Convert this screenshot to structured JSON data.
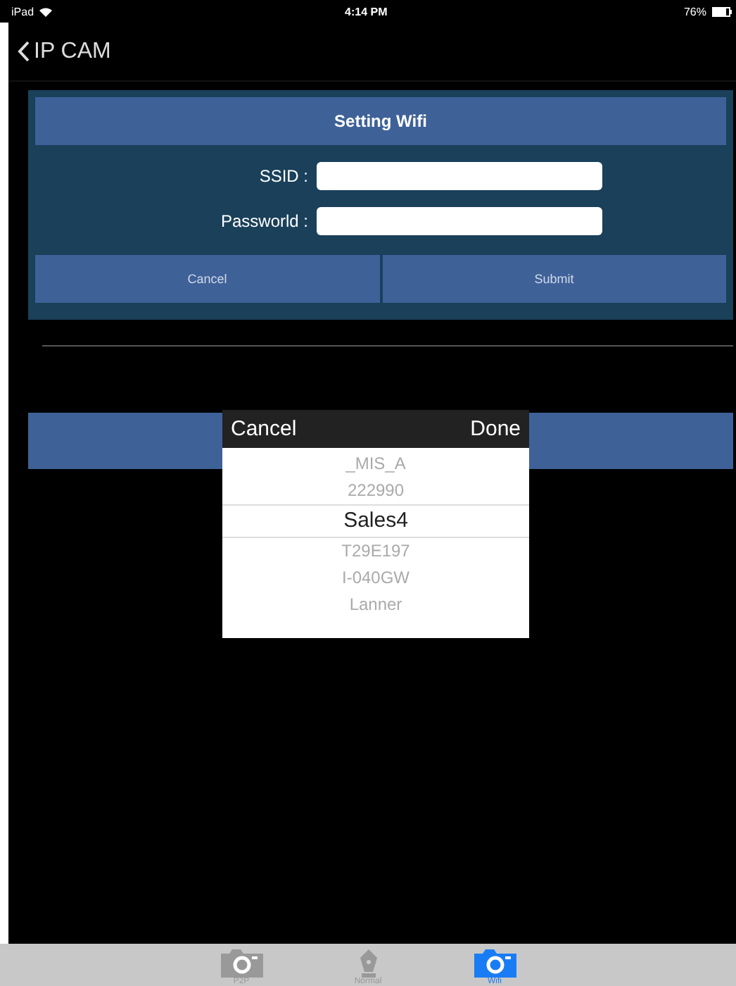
{
  "status_bar": {
    "device": "iPad",
    "time": "4:14 PM",
    "battery": "76%"
  },
  "nav": {
    "back_label": "IP CAM"
  },
  "dialog": {
    "title": "Setting Wifi",
    "fields": [
      {
        "label": "SSID :"
      },
      {
        "label": "Passworld :"
      }
    ],
    "buttons": [
      "Cancel",
      "Submit"
    ]
  },
  "picker": {
    "cancel": "Cancel",
    "done": "Done",
    "items": [
      {
        "label": "_MIS_A",
        "selected": false
      },
      {
        "label": "222990",
        "selected": false
      },
      {
        "label": "Sales4",
        "selected": true
      },
      {
        "label": "T29E197",
        "selected": false
      },
      {
        "label": "I-040GW",
        "selected": false
      },
      {
        "label": "Lanner",
        "selected": false
      }
    ]
  },
  "tab_bar": [
    {
      "label": "P2P",
      "kind": "camera",
      "selected": false
    },
    {
      "label": "Normal",
      "kind": "pen",
      "selected": false
    },
    {
      "label": "Wifi",
      "kind": "camera",
      "selected": true
    }
  ]
}
